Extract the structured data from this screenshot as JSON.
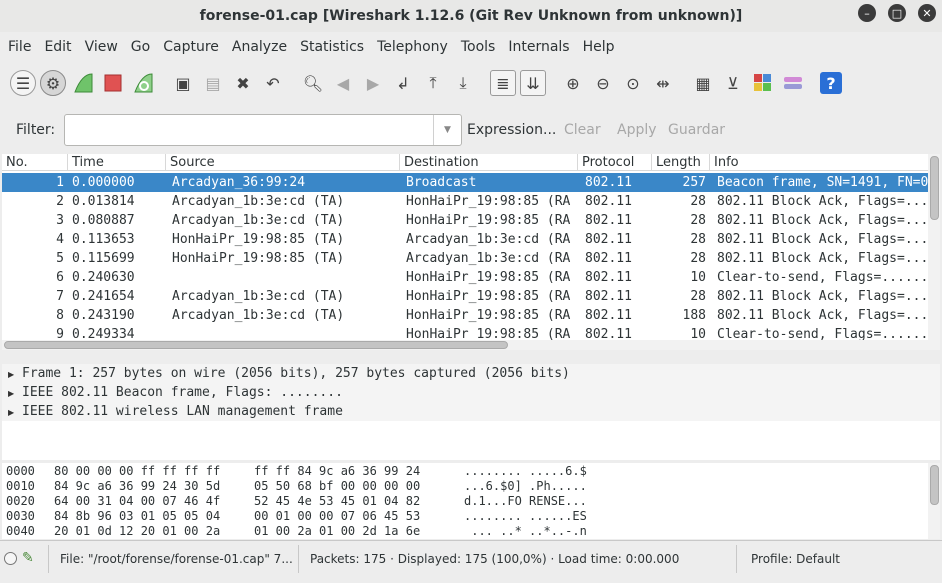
{
  "window": {
    "title": "forense-01.cap  [Wireshark 1.12.6  (Git Rev Unknown from unknown)]"
  },
  "menu": [
    "File",
    "Edit",
    "View",
    "Go",
    "Capture",
    "Analyze",
    "Statistics",
    "Telephony",
    "Tools",
    "Internals",
    "Help"
  ],
  "filter": {
    "label": "Filter:",
    "value": "",
    "expression": "Expression...",
    "clear": "Clear",
    "apply": "Apply",
    "save": "Guardar"
  },
  "packet_list": {
    "columns": [
      "No.",
      "Time",
      "Source",
      "Destination",
      "Protocol",
      "Length",
      "Info"
    ],
    "rows": [
      {
        "no": "1",
        "time": "0.000000",
        "source": "Arcadyan_36:99:24",
        "destination": "Broadcast",
        "protocol": "802.11",
        "length": "257",
        "info": "Beacon frame, SN=1491, FN=0"
      },
      {
        "no": "2",
        "time": "0.013814",
        "source": "Arcadyan_1b:3e:cd (TA)",
        "destination": "HonHaiPr_19:98:85 (RA",
        "protocol": "802.11",
        "length": "28",
        "info": "802.11 Block Ack, Flags=...."
      },
      {
        "no": "3",
        "time": "0.080887",
        "source": "Arcadyan_1b:3e:cd (TA)",
        "destination": "HonHaiPr_19:98:85 (RA",
        "protocol": "802.11",
        "length": "28",
        "info": "802.11 Block Ack, Flags=...."
      },
      {
        "no": "4",
        "time": "0.113653",
        "source": "HonHaiPr_19:98:85 (TA)",
        "destination": "Arcadyan_1b:3e:cd (RA",
        "protocol": "802.11",
        "length": "28",
        "info": "802.11 Block Ack, Flags=...."
      },
      {
        "no": "5",
        "time": "0.115699",
        "source": "HonHaiPr_19:98:85 (TA)",
        "destination": "Arcadyan_1b:3e:cd (RA",
        "protocol": "802.11",
        "length": "28",
        "info": "802.11 Block Ack, Flags=...."
      },
      {
        "no": "6",
        "time": "0.240630",
        "source": "",
        "destination": "HonHaiPr_19:98:85 (RA",
        "protocol": "802.11",
        "length": "10",
        "info": "Clear-to-send, Flags=......"
      },
      {
        "no": "7",
        "time": "0.241654",
        "source": "Arcadyan_1b:3e:cd (TA)",
        "destination": "HonHaiPr_19:98:85 (RA",
        "protocol": "802.11",
        "length": "28",
        "info": "802.11 Block Ack, Flags=...."
      },
      {
        "no": "8",
        "time": "0.243190",
        "source": "Arcadyan_1b:3e:cd (TA)",
        "destination": "HonHaiPr_19:98:85 (RA",
        "protocol": "802.11",
        "length": "188",
        "info": "802.11 Block Ack, Flags=...."
      },
      {
        "no": "9",
        "time": "0.249334",
        "source": "",
        "destination": "HonHaiPr_19:98:85 (RA",
        "protocol": "802.11",
        "length": "10",
        "info": "Clear-to-send, Flags=......"
      }
    ]
  },
  "details": [
    "Frame 1: 257 bytes on wire (2056 bits), 257 bytes captured (2056 bits)",
    "IEEE 802.11 Beacon frame, Flags: ........",
    "IEEE 802.11 wireless LAN management frame"
  ],
  "bytes": [
    {
      "offset": "0000",
      "hex1": "80 00 00 00 ff ff ff ff",
      "hex2": "ff ff 84 9c a6 36 99 24",
      "ascii": "........ .....6.$"
    },
    {
      "offset": "0010",
      "hex1": "84 9c a6 36 99 24 30 5d",
      "hex2": "05 50 68 bf 00 00 00 00",
      "ascii": "...6.$0] .Ph....."
    },
    {
      "offset": "0020",
      "hex1": "64 00 31 04 00 07 46 4f",
      "hex2": "52 45 4e 53 45 01 04 82",
      "ascii": "d.1...FO RENSE..."
    },
    {
      "offset": "0030",
      "hex1": "84 8b 96 03 01 05 05 04",
      "hex2": "00 01 00 00 07 06 45 53",
      "ascii": "........ ......ES"
    },
    {
      "offset": "0040",
      "hex1": "20 01 0d 12 20 01 00 2a",
      "hex2": "01 00 2a 01 00 2d 1a 6e",
      "ascii": " ... ..* ..*..-.n"
    }
  ],
  "status": {
    "file": "File: \"/root/forense/forense-01.cap\" 7...",
    "packets": "Packets: 175 · Displayed: 175 (100,0%) · Load time: 0:00.000",
    "profile": "Profile: Default"
  },
  "colors": {
    "selection": "#3a87c8",
    "help": "#2a6fd6"
  }
}
